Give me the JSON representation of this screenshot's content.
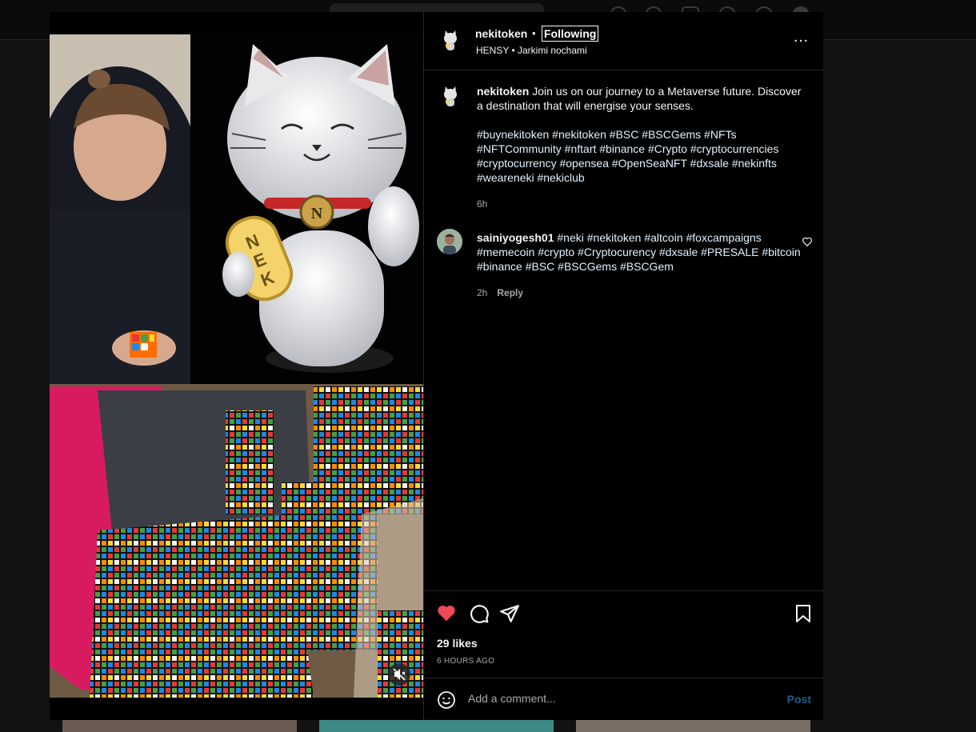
{
  "post": {
    "author": "nekitoken",
    "follow_status": "Following",
    "separator": "•",
    "audio": "HENSY • Jarkimi nochami",
    "more_icon": "…"
  },
  "caption": {
    "username": "nekitoken",
    "text": "Join us on our journey to a Metaverse future. Discover a destination that will energise your senses.",
    "hashtags": "#buynekitoken #nekitoken #BSC #BSCGems #NFTs #NFTCommunity #nftart #binance #Crypto #cryptocurrencies #cryptocurrency #opensea #OpenSeaNFT #dxsale #nekinfts #weareneki #nekiclub",
    "time": "6h"
  },
  "comments": [
    {
      "username": "sainiyogesh01",
      "text": "#neki #nekitoken #altcoin #foxcampaigns #memecoin #crypto #Cryptocurency #dxsale #PRESALE #bitcoin #binance #BSC #BSCGems #BSCGem",
      "time": "2h",
      "reply_label": "Reply"
    }
  ],
  "actions": {
    "likes": "29 likes",
    "posted_ago": "6 HOURS AGO"
  },
  "comment_box": {
    "placeholder": "Add a comment...",
    "post_label": "Post"
  },
  "colors": {
    "like": "#ed4956",
    "hashtag": "#e0f1ff",
    "post_button": "#1e5a8a"
  }
}
